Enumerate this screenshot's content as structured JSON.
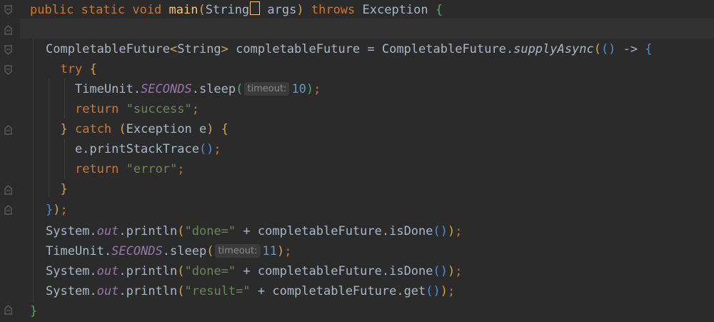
{
  "editor": {
    "lines": [
      {
        "id": "l1",
        "tokens": [
          {
            "t": "public",
            "c": "kw"
          },
          {
            "t": " "
          },
          {
            "t": "static",
            "c": "kw"
          },
          {
            "t": " "
          },
          {
            "t": "void",
            "c": "kw"
          },
          {
            "t": " "
          },
          {
            "t": "main",
            "c": "fn"
          },
          {
            "t": "(",
            "c": "p1"
          },
          {
            "t": "String"
          },
          {
            "t": "[]",
            "c": "bracket"
          },
          {
            "t": " args"
          },
          {
            "t": ")",
            "c": "p1"
          },
          {
            "t": " "
          },
          {
            "t": "throws",
            "c": "kw"
          },
          {
            "t": " Exception "
          },
          {
            "t": "{",
            "c": "p3"
          }
        ]
      },
      {
        "id": "l2",
        "tokens": []
      },
      {
        "id": "l3",
        "tokens": [
          {
            "t": "CompletableFuture"
          },
          {
            "t": "<",
            "c": "p1"
          },
          {
            "t": "String"
          },
          {
            "t": ">",
            "c": "p1"
          },
          {
            "t": " completableFuture = CompletableFuture."
          },
          {
            "t": "supplyAsync",
            "c": "smeth"
          },
          {
            "t": "(",
            "c": "p1"
          },
          {
            "t": "()",
            "c": "p2"
          },
          {
            "t": " -> "
          },
          {
            "t": "{",
            "c": "p2"
          }
        ]
      },
      {
        "id": "l4",
        "tokens": [
          {
            "t": "  "
          },
          {
            "t": "try",
            "c": "kw"
          },
          {
            "t": " "
          },
          {
            "t": "{",
            "c": "p1"
          }
        ]
      },
      {
        "id": "l5",
        "tokens": [
          {
            "t": "    TimeUnit."
          },
          {
            "t": "SECONDS",
            "c": "stat"
          },
          {
            "t": ".sleep"
          },
          {
            "t": "(",
            "c": "p3"
          },
          {
            "t": "timeout:",
            "c": "hint"
          },
          {
            "t": "10",
            "c": "num"
          },
          {
            "t": ")",
            "c": "p3"
          },
          {
            "t": ";",
            "c": "kw"
          }
        ]
      },
      {
        "id": "l6",
        "tokens": [
          {
            "t": "    "
          },
          {
            "t": "return",
            "c": "kw"
          },
          {
            "t": " "
          },
          {
            "t": "\"success\"",
            "c": "str"
          },
          {
            "t": ";",
            "c": "kw"
          }
        ]
      },
      {
        "id": "l7",
        "tokens": [
          {
            "t": "  "
          },
          {
            "t": "}",
            "c": "p1"
          },
          {
            "t": " "
          },
          {
            "t": "catch",
            "c": "kw"
          },
          {
            "t": " "
          },
          {
            "t": "(",
            "c": "p1"
          },
          {
            "t": "Exception e"
          },
          {
            "t": ")",
            "c": "p1"
          },
          {
            "t": " "
          },
          {
            "t": "{",
            "c": "p1"
          }
        ]
      },
      {
        "id": "l8",
        "tokens": [
          {
            "t": "    e.printStackTrace"
          },
          {
            "t": "()",
            "c": "p2"
          },
          {
            "t": ";",
            "c": "kw"
          }
        ]
      },
      {
        "id": "l9",
        "tokens": [
          {
            "t": "    "
          },
          {
            "t": "return",
            "c": "kw"
          },
          {
            "t": " "
          },
          {
            "t": "\"error\"",
            "c": "str"
          },
          {
            "t": ";",
            "c": "kw"
          }
        ]
      },
      {
        "id": "l10",
        "tokens": [
          {
            "t": "  "
          },
          {
            "t": "}",
            "c": "p1"
          }
        ]
      },
      {
        "id": "l11",
        "tokens": [
          {
            "t": "}",
            "c": "p2"
          },
          {
            "t": ")",
            "c": "p1"
          },
          {
            "t": ";",
            "c": "kw"
          }
        ]
      },
      {
        "id": "l12",
        "tokens": [
          {
            "t": "System."
          },
          {
            "t": "out",
            "c": "field"
          },
          {
            "t": ".println"
          },
          {
            "t": "(",
            "c": "p1"
          },
          {
            "t": "\"done=\"",
            "c": "str"
          },
          {
            "t": " + completableFuture.isDone"
          },
          {
            "t": "()",
            "c": "p2"
          },
          {
            "t": ")",
            "c": "p1"
          },
          {
            "t": ";",
            "c": "kw"
          }
        ]
      },
      {
        "id": "l13",
        "tokens": [
          {
            "t": "TimeUnit."
          },
          {
            "t": "SECONDS",
            "c": "stat"
          },
          {
            "t": ".sleep"
          },
          {
            "t": "(",
            "c": "p1"
          },
          {
            "t": "timeout:",
            "c": "hint"
          },
          {
            "t": "11",
            "c": "num"
          },
          {
            "t": ")",
            "c": "p1"
          },
          {
            "t": ";",
            "c": "kw"
          }
        ]
      },
      {
        "id": "l14",
        "tokens": [
          {
            "t": "System."
          },
          {
            "t": "out",
            "c": "field"
          },
          {
            "t": ".println"
          },
          {
            "t": "(",
            "c": "p1"
          },
          {
            "t": "\"done=\"",
            "c": "str"
          },
          {
            "t": " + completableFuture.isDone"
          },
          {
            "t": "()",
            "c": "p2"
          },
          {
            "t": ")",
            "c": "p1"
          },
          {
            "t": ";",
            "c": "kw"
          }
        ]
      },
      {
        "id": "l15",
        "tokens": [
          {
            "t": "System."
          },
          {
            "t": "out",
            "c": "field"
          },
          {
            "t": ".println"
          },
          {
            "t": "(",
            "c": "p1"
          },
          {
            "t": "\"result=\"",
            "c": "str"
          },
          {
            "t": " + completableFuture.get"
          },
          {
            "t": "()",
            "c": "p2"
          },
          {
            "t": ")",
            "c": "p1"
          },
          {
            "t": ";",
            "c": "kw"
          }
        ]
      },
      {
        "id": "l16",
        "tokens": [
          {
            "t": "}",
            "c": "p3"
          }
        ]
      }
    ]
  },
  "colors": {
    "background": "#2b2b2b",
    "current_line": "#323232",
    "text": "#a9b7c6",
    "keyword": "#cc7832",
    "method": "#ffc66d",
    "string": "#6a8759",
    "number": "#6897bb",
    "static_field": "#9876aa",
    "inlay_hint": "#8a8a8a"
  }
}
